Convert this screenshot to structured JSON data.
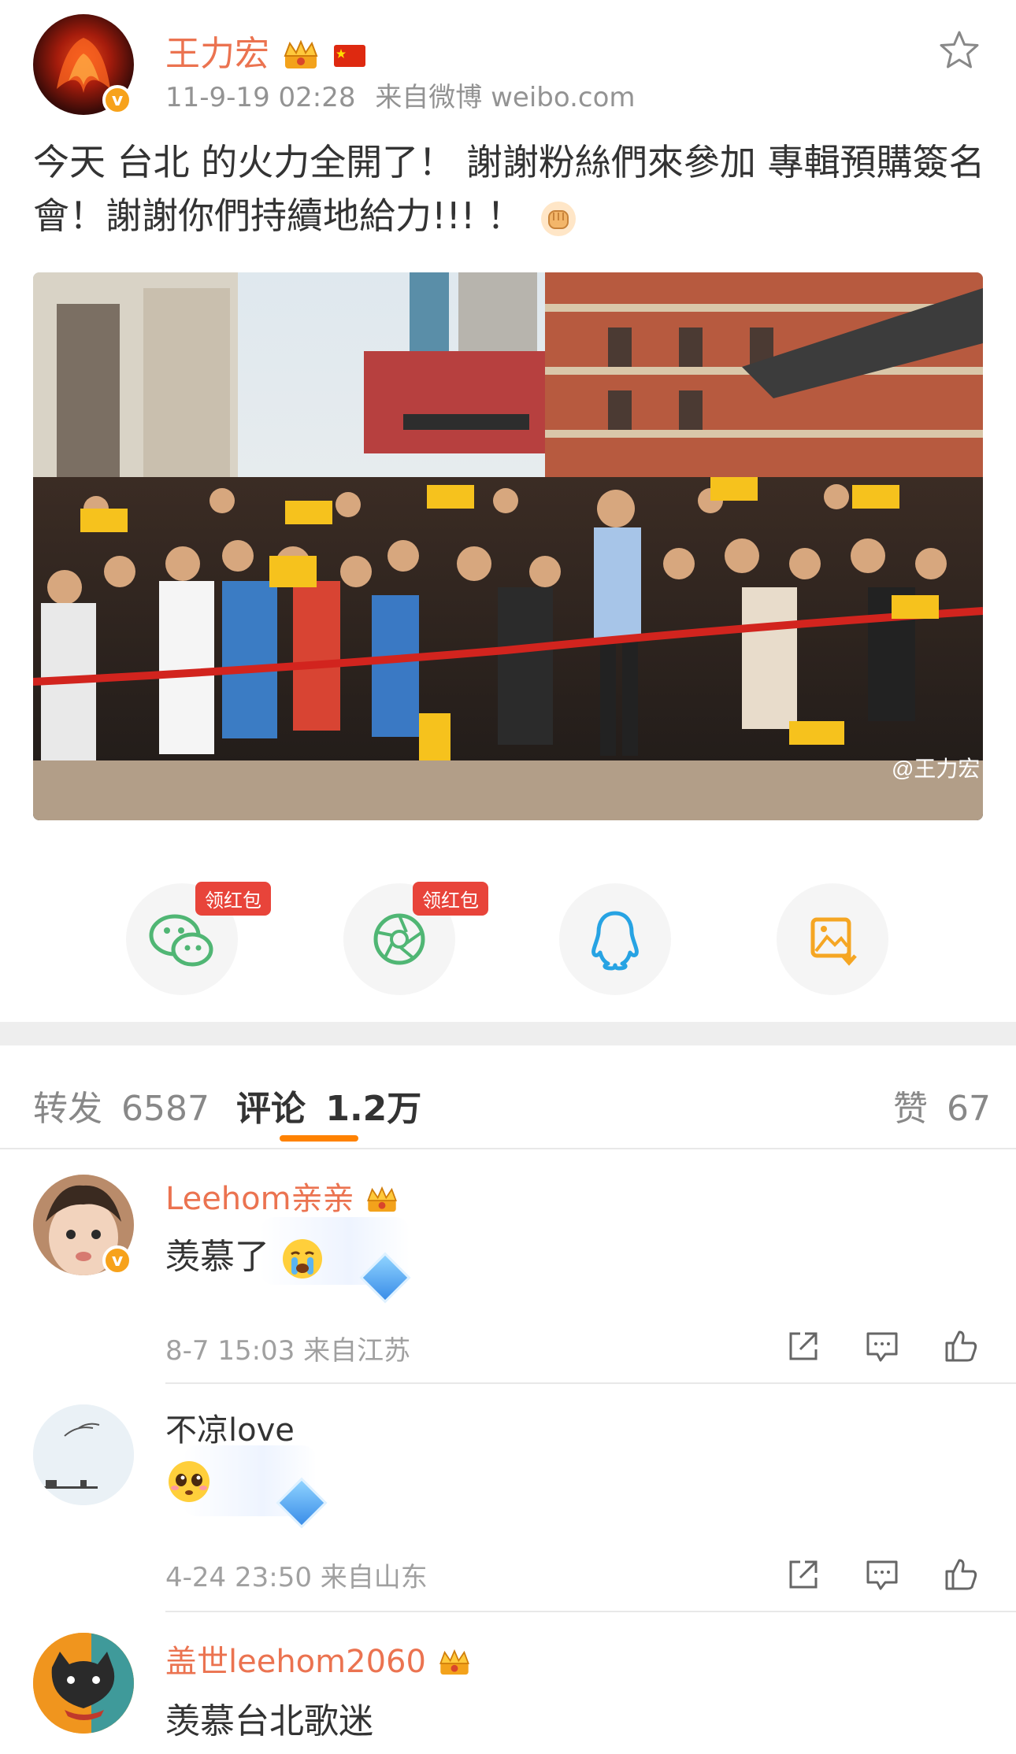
{
  "post": {
    "username": "王力宏",
    "timestamp": "11-9-19 02:28",
    "source": "来自微博 weibo.com",
    "text": "今天 台北 的火力全開了！ 謝謝粉絲們來參加 專輯預購簽名會！謝謝你們持續地給力!!! ！",
    "photo_watermark": "@王力宏"
  },
  "share": {
    "wechat_badge": "领红包",
    "moments_badge": "领红包",
    "icons": [
      "wechat-icon",
      "moments-icon",
      "qq-icon",
      "save-image-icon"
    ]
  },
  "tabs": {
    "repost_label": "转发",
    "repost_count": "6587",
    "comment_label": "评论",
    "comment_count": "1.2万",
    "like_label": "赞",
    "like_count": "67"
  },
  "comments": [
    {
      "name": "Leehom亲亲",
      "text": "羡慕了",
      "meta": "8-7 15:03 来自江苏"
    },
    {
      "name": "不凉love",
      "text": "",
      "meta": "4-24 23:50 来自山东"
    },
    {
      "name": "盖世leehom2060",
      "text": "羡慕台北歌迷",
      "meta": ""
    }
  ],
  "colors": {
    "accent": "#ff8200",
    "username": "#eb7350",
    "redpack": "#e8443a"
  }
}
